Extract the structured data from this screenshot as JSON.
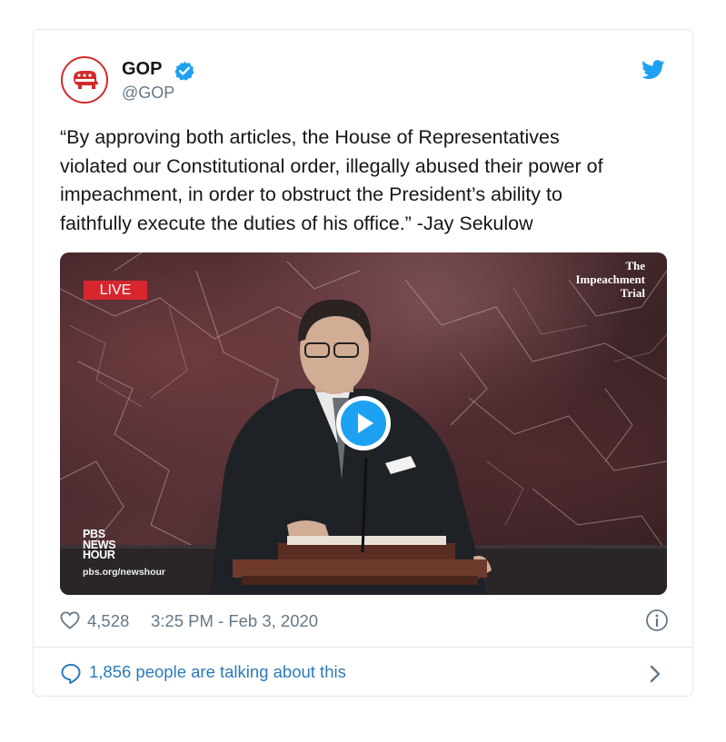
{
  "account": {
    "name": "GOP",
    "handle": "@GOP",
    "verified_icon": "verified-badge-icon",
    "avatar_icon": "republican-elephant-icon",
    "platform_icon": "twitter-bird-icon"
  },
  "tweet": {
    "lines": [
      "“By approving both articles, the House of Representatives",
      "violated our Constitutional order, illegally abused their power of",
      "impeachment, in order to obstruct the President’s ability to",
      "faithfully execute the duties of his office.”  -Jay Sekulow"
    ]
  },
  "media": {
    "live_label": "LIVE",
    "trial_logo": [
      "The",
      "Impeachment",
      "Trial"
    ],
    "pbs_logo": [
      "PBS",
      "NEWS",
      "HOUR"
    ],
    "pbs_url": "pbs.org/newshour",
    "play_icon": "play-icon"
  },
  "meta": {
    "likes": "4,528",
    "timestamp": "3:25 PM - Feb 3, 2020"
  },
  "footer": {
    "talking_text": "1,856 people are talking about this"
  },
  "colors": {
    "twitter_blue": "#1da1f2",
    "link_blue": "#2b7bb9",
    "secondary_text": "#657786",
    "live_red": "#d8262d",
    "gop_red": "#d32a2a"
  }
}
